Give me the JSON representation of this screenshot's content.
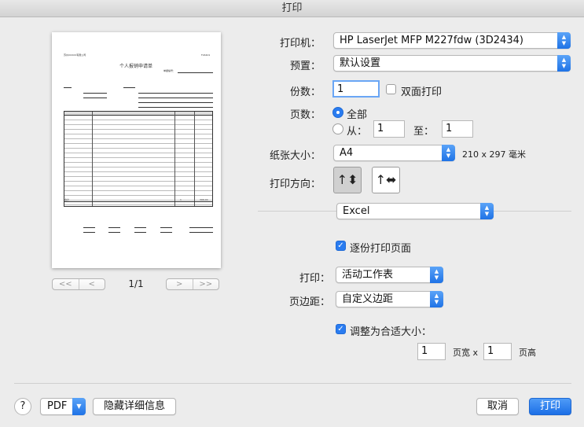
{
  "window": {
    "title": "打印"
  },
  "preview": {
    "doc_company": "苏州XXXXX有限公司",
    "doc_code": "F24401",
    "doc_title": "个人报销申请单",
    "doc_no_label": "单据编号：",
    "page_indicator": "1/1",
    "nav_first": "<<",
    "nav_prev": "<",
    "nav_next": ">",
    "nav_last": ">>",
    "row_total_label": "合计",
    "row_total_value": "1",
    "row_total_amount": "396.00"
  },
  "printer": {
    "label": "打印机：",
    "value": "HP LaserJet MFP M227fdw (3D2434)"
  },
  "preset": {
    "label": "预置：",
    "value": "默认设置"
  },
  "copies": {
    "label": "份数：",
    "value": "1",
    "duplex_label": "双面打印"
  },
  "pages": {
    "label": "页数：",
    "all_label": "全部",
    "from_label": "从：",
    "from_value": "1",
    "to_label": "至：",
    "to_value": "1"
  },
  "paper_size": {
    "label": "纸张大小：",
    "value": "A4",
    "dimensions": "210 x 297 毫米"
  },
  "orientation": {
    "label": "打印方向："
  },
  "app_section": {
    "value": "Excel"
  },
  "collate": {
    "label": "逐份打印页面"
  },
  "print_what": {
    "label": "打印：",
    "value": "活动工作表"
  },
  "margins": {
    "label": "页边距：",
    "value": "自定义边距"
  },
  "scale": {
    "label": "调整为合适大小：",
    "width_value": "1",
    "width_label": "页宽 x",
    "height_value": "1",
    "height_label": "页高"
  },
  "footer": {
    "help": "?",
    "pdf_label": "PDF",
    "hide_details": "隐藏详细信息",
    "cancel": "取消",
    "print": "打印"
  },
  "colors": {
    "accent": "#2a7cf0"
  }
}
